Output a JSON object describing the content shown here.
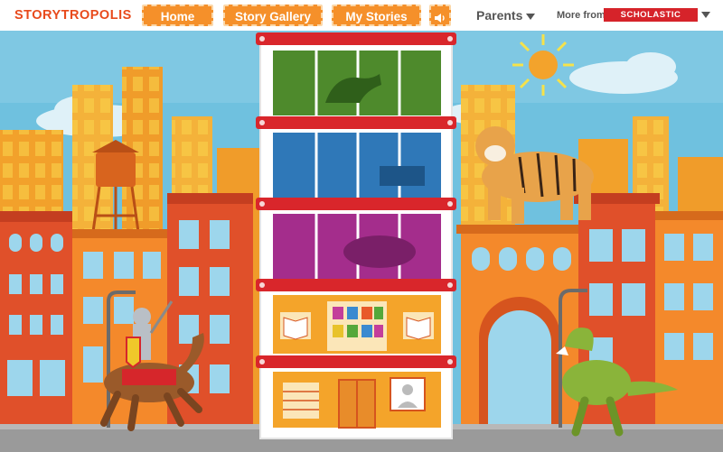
{
  "header": {
    "logo": "STORYTROPOLIS",
    "nav": {
      "home": "Home",
      "story_gallery": "Story Gallery",
      "my_stories": "My Stories",
      "sound_icon": "speaker-icon"
    },
    "parents": "Parents",
    "more_from": "More from",
    "brand_badge": "SCHOLASTIC"
  },
  "colors": {
    "logo": "#e84a1c",
    "nav_button": "#f5902a",
    "sky": "#6fc1df",
    "building_orange": "#f4a42a",
    "building_red": "#e0502a",
    "scholastic_red": "#d6232a",
    "floor_green": "#4e8a2c",
    "floor_blue": "#2f78b8",
    "floor_magenta": "#a42d8c"
  },
  "scene": {
    "characters": [
      "tiger",
      "knight-on-horse",
      "t-rex"
    ],
    "tower_floors": [
      "green",
      "blue",
      "magenta",
      "library",
      "lobby"
    ]
  }
}
